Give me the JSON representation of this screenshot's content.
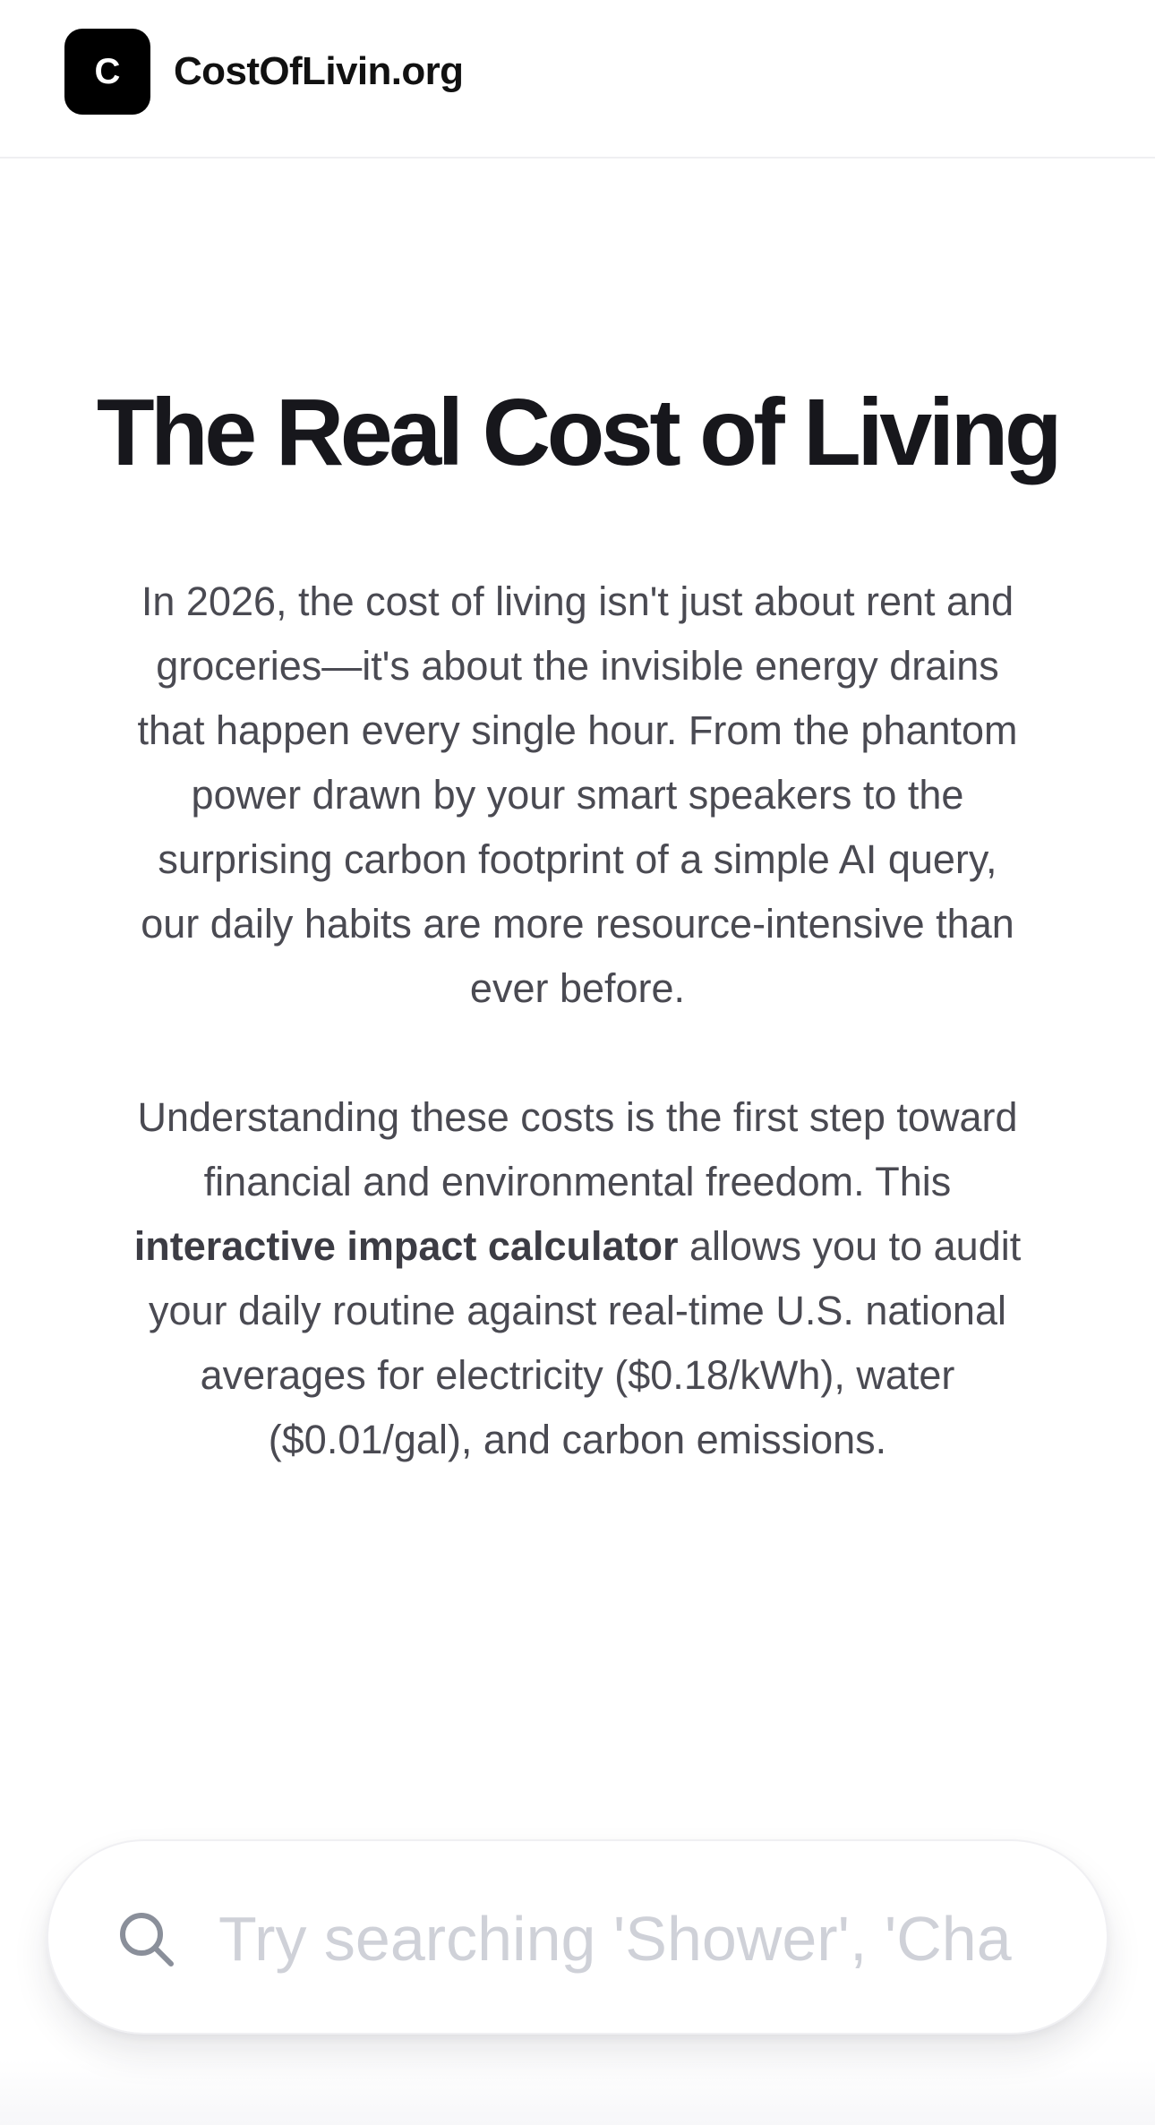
{
  "header": {
    "logo_letter": "C",
    "site_name": "CostOfLivin.org"
  },
  "hero": {
    "title": "The Real Cost of Living",
    "intro_paragraph_1": "In 2026, the cost of living isn't just about rent and groceries—it's about the invisible energy drains that happen every single hour. From the phantom power drawn by your smart speakers to the surprising carbon footprint of a simple AI query, our daily habits are more resource-intensive than ever before.",
    "intro_paragraph_2_before": "Understanding these costs is the first step toward financial and environmental freedom. This ",
    "intro_paragraph_2_bold": "interactive impact calculator",
    "intro_paragraph_2_after": " allows you to audit your daily routine against real-time U.S. national averages for electricity ($0.18/kWh), water ($0.01/gal), and carbon emissions."
  },
  "search": {
    "placeholder": "Try searching 'Shower', 'Cha",
    "value": "",
    "icon": "search-icon"
  },
  "colors": {
    "logo_bg": "#000000",
    "title": "#17171c",
    "body_text": "#4a4a52",
    "placeholder": "#cfd1d8",
    "icon": "#8a8f9a"
  }
}
